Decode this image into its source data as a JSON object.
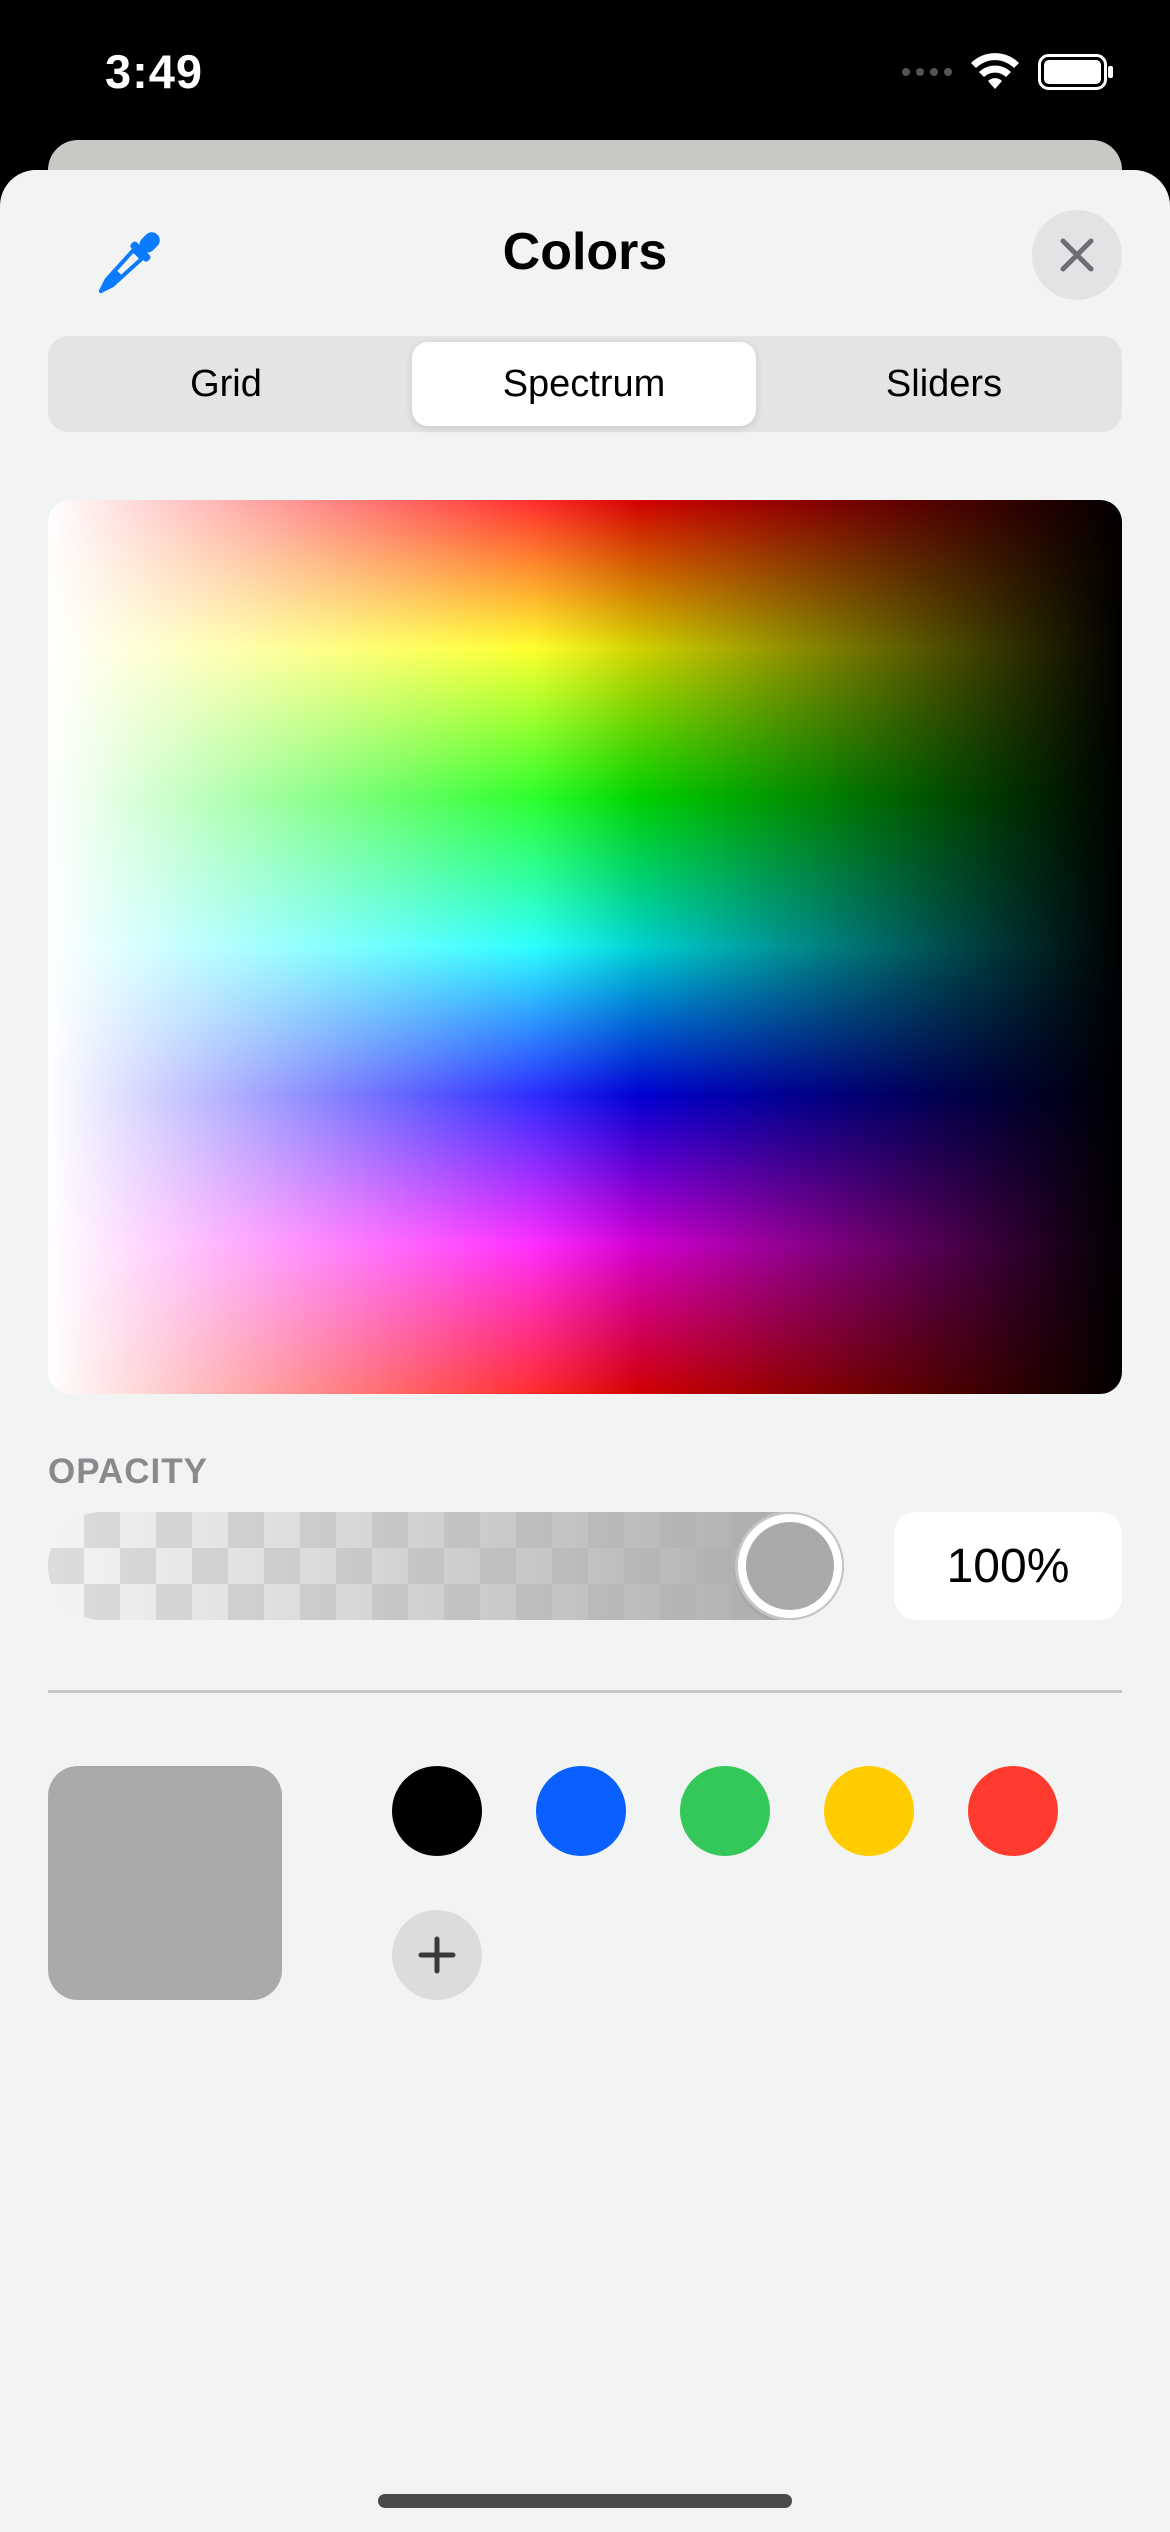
{
  "status_bar": {
    "time": "3:49"
  },
  "sheet": {
    "title": "Colors"
  },
  "tabs": [
    {
      "label": "Grid",
      "active": false
    },
    {
      "label": "Spectrum",
      "active": true
    },
    {
      "label": "Sliders",
      "active": false
    }
  ],
  "opacity": {
    "label": "OPACITY",
    "value_text": "100%",
    "level": 1.0
  },
  "current_color": "#aaaaaa",
  "swatches": [
    {
      "name": "black",
      "color": "#000000"
    },
    {
      "name": "blue",
      "color": "#0a60ff"
    },
    {
      "name": "green",
      "color": "#34c759"
    },
    {
      "name": "yellow",
      "color": "#ffcc00"
    },
    {
      "name": "red",
      "color": "#ff3b30"
    }
  ],
  "accent_color": "#0a7aff"
}
